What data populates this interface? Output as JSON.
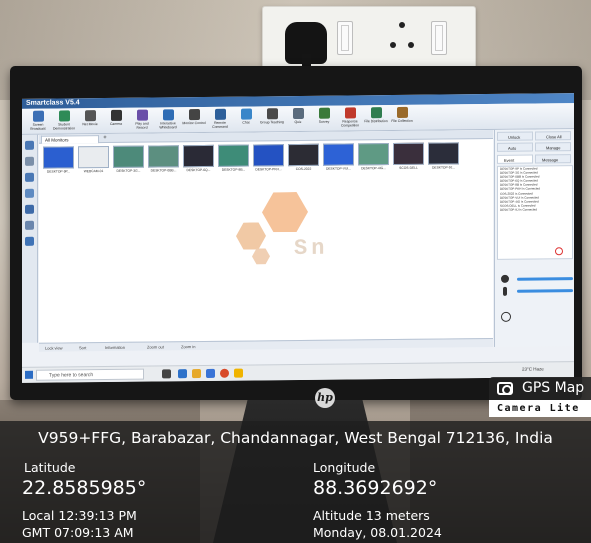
{
  "screen_ui": {
    "window_title": "Smartclass V5.4",
    "ribbon": [
      "Screen Broadcast",
      "Student Demonstration",
      "Net Movie",
      "Camera",
      "Play and Record",
      "Interactive Whiteboard",
      "Monitor Control",
      "Remote Command",
      "Chat",
      "Group Teaching",
      "Quiz",
      "Survey",
      "Response Competition",
      "File Distribution",
      "File Collection"
    ],
    "tab_label": "All Monitors",
    "thumbnails": [
      "DESKTOP-9P...",
      "WEBCAM-01",
      "DESKTOP-3G...",
      "DESKTOP-0BB...",
      "DESKTOP-6Q...",
      "DESKTOP-8B...",
      "DESKTOP-PKH...",
      "COS-2022",
      "DESKTOP-VUI...",
      "DESKTOP-4IG...",
      "SCOS-DELL",
      "DESKTOP-9J..."
    ],
    "logo_text": "Sn",
    "statusbar": [
      "Lock view",
      "Sort",
      "Information",
      "Zoom out",
      "Zoom in"
    ],
    "right_panel_buttons": [
      "Unlock",
      "Close All",
      "Auto Connect",
      "Manage"
    ],
    "right_panel_tabs": [
      "Event",
      "Message"
    ],
    "log_lines": [
      "DESKTOP-9P Is Connected",
      "DESKTOP-3G Is Connected",
      "DESKTOP-0BB Is Connected",
      "DESKTOP-6Q Is Connected",
      "DESKTOP-8B Is Connected",
      "DESKTOP-PKH Is Connected",
      "COS-2022 Is Connected",
      "DESKTOP-VUI Is Connected",
      "DESKTOP-4IG Is Connected",
      "SCOS-DELL Is Connected",
      "DESKTOP-9J Is Connected"
    ],
    "taskbar_search": "Type here to search",
    "tray_weather": "23°C Haze"
  },
  "gps_overlay": {
    "app_title": "GPS Map",
    "app_subtitle": "Camera Lite",
    "address": "V959+FFG, Barabazar, Chandannagar, West Bengal 712136, India",
    "latitude_label": "Latitude",
    "latitude_value": "22.8585985°",
    "longitude_label": "Longitude",
    "longitude_value": "88.3692692°",
    "local_time": "Local 12:39:13 PM",
    "gmt_time": "GMT 07:09:13 AM",
    "altitude": "Altitude 13 meters",
    "date": "Monday, 08.01.2024"
  },
  "monitor_brand_icon": "hp-logo-icon",
  "colors": {
    "overlay_bg": "#1e1e1e",
    "accent_blue": "#3a8de0"
  }
}
